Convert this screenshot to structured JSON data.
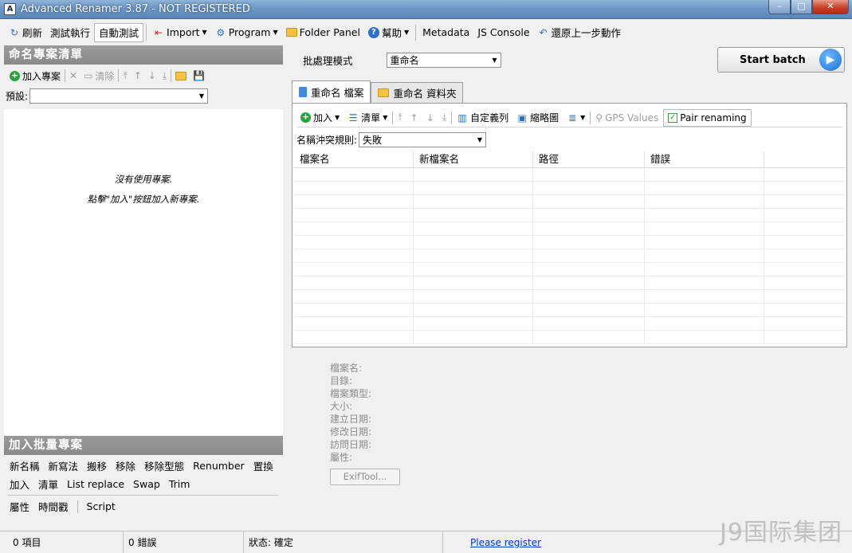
{
  "window": {
    "title": "Advanced Renamer 3.87 - NOT REGISTERED",
    "minimize": "–",
    "maximize": "□",
    "close": "✕"
  },
  "toolbar": {
    "refresh": "刷新",
    "test_run": "測試執行",
    "auto_test": "自動測試",
    "import": "Import",
    "program": "Program",
    "folder_panel": "Folder Panel",
    "help": "幫助",
    "metadata": "Metadata",
    "js_console": "JS Console",
    "undo": "還原上一步動作"
  },
  "left": {
    "header": "命名專案清單",
    "add_project": "加入專案",
    "clear": "清除",
    "preset_label": "預設:",
    "preset_value": "",
    "empty_msg1": "沒有使用專案.",
    "empty_msg2": "點擊\"加入\"按鈕加入新專案.",
    "batch_header": "加入批量專案",
    "batch_row1": [
      "新名稱",
      "新寫法",
      "搬移",
      "移除",
      "移除型態",
      "Renumber",
      "置換"
    ],
    "batch_row2": [
      "加入",
      "清單",
      "List replace",
      "Swap",
      "Trim"
    ],
    "batch_row3": [
      "屬性",
      "時間戳",
      "Script"
    ]
  },
  "right": {
    "batch_mode_label": "批處理模式",
    "batch_mode_value": "重命名",
    "start_batch": "Start batch",
    "tab_files": "重命名 檔案",
    "tab_folders": "重命名 資料夾",
    "add": "加入",
    "list": "清單",
    "custom_columns": "自定義列",
    "thumbnails": "縮略圖",
    "gps_values": "GPS Values",
    "pair_renaming": "Pair renaming",
    "conflict_label": "名稱沖突規則:",
    "conflict_value": "失敗",
    "columns": [
      "檔案名",
      "新檔案名",
      "路徑",
      "錯誤",
      ""
    ],
    "info_labels": [
      "檔案名:",
      "目錄:",
      "檔案類型:",
      "大小:",
      "建立日期:",
      "修改日期:",
      "訪問日期:",
      "屬性:"
    ],
    "exiftool": "ExifTool..."
  },
  "status": {
    "items": "0 項目",
    "errors": "0 錯誤",
    "state": "狀态: 確定",
    "register": "Please register"
  },
  "watermark": "J9国际集团"
}
